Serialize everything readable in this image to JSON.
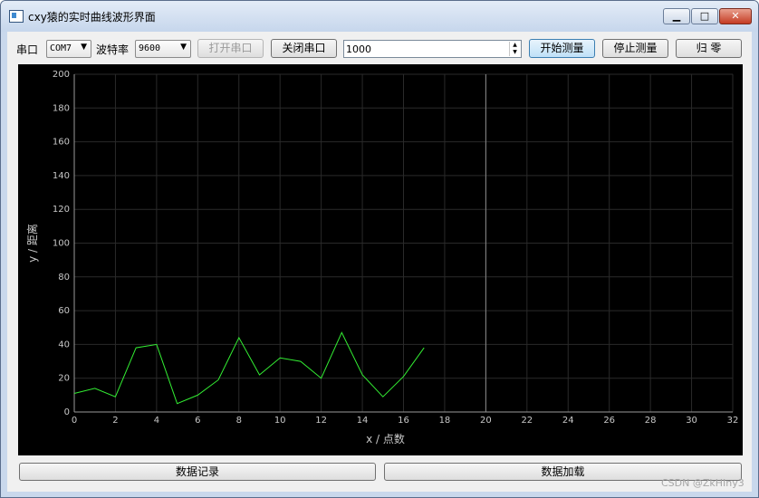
{
  "window": {
    "title": "cxy猿的实时曲线波形界面"
  },
  "toolbar": {
    "port_label": "串口",
    "port_value": "COM7",
    "baud_label": "波特率",
    "baud_value": "9600",
    "open_port": "打开串口",
    "close_port": "关闭串口",
    "interval_value": "1000",
    "start_measure": "开始测量",
    "stop_measure": "停止测量",
    "zero": "归 零"
  },
  "bottom": {
    "record": "数据记录",
    "load": "数据加载"
  },
  "watermark": "CSDN @ZkHIny3",
  "chart_data": {
    "type": "line",
    "xlabel": "x / 点数",
    "ylabel": "y / 距离",
    "xlim": [
      0,
      32
    ],
    "ylim": [
      0,
      200
    ],
    "xticks": [
      0,
      2,
      4,
      6,
      8,
      10,
      12,
      14,
      16,
      18,
      20,
      22,
      24,
      26,
      28,
      30,
      32
    ],
    "yticks": [
      0,
      20,
      40,
      60,
      80,
      100,
      120,
      140,
      160,
      180,
      200
    ],
    "grid": true,
    "series": [
      {
        "color": "#33ee33",
        "x": [
          0,
          1,
          2,
          3,
          4,
          5,
          6,
          7,
          8,
          9,
          10,
          11,
          12,
          13,
          14,
          15,
          16,
          17
        ],
        "y": [
          11,
          14,
          9,
          38,
          40,
          5,
          10,
          19,
          44,
          22,
          32,
          30,
          20,
          47,
          22,
          9,
          21,
          38
        ]
      }
    ],
    "marker_x": 20
  }
}
